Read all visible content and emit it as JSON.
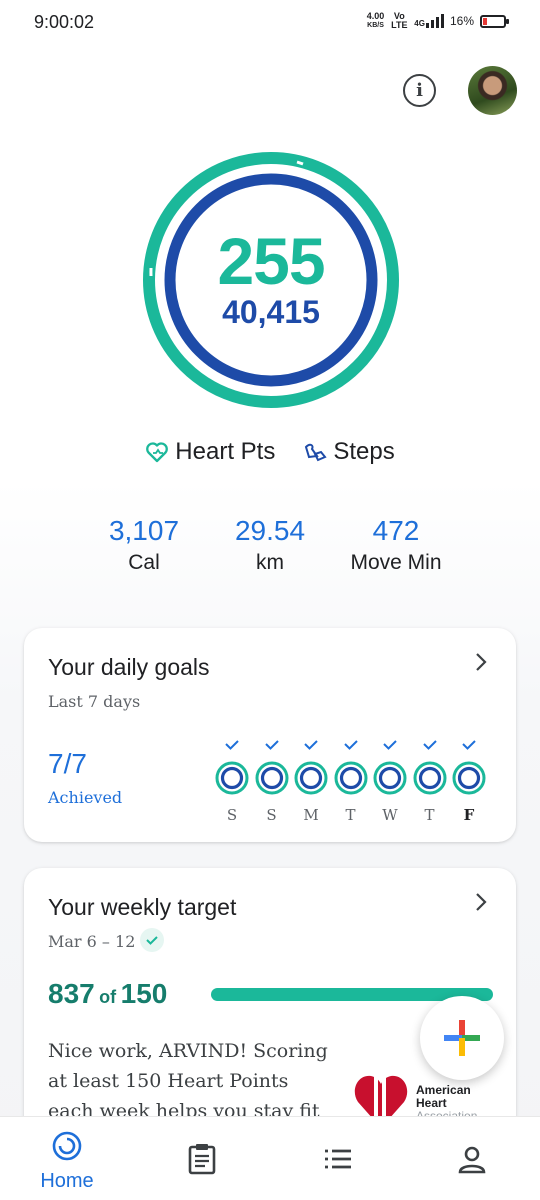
{
  "status": {
    "time": "9:00:02",
    "net_speed_value": "4.00",
    "net_speed_unit": "KB/S",
    "volte": "Vo LTE",
    "network": "4G",
    "battery": "16%"
  },
  "summary": {
    "heart_pts": "255",
    "steps": "40,415",
    "heart_label": "Heart Pts",
    "steps_label": "Steps"
  },
  "stats": [
    {
      "value": "3,107",
      "label": "Cal"
    },
    {
      "value": "29.54",
      "label": "km"
    },
    {
      "value": "472",
      "label": "Move Min"
    }
  ],
  "daily_goals": {
    "title": "Your daily goals",
    "subtitle": "Last 7 days",
    "achieved_value": "7/7",
    "achieved_label": "Achieved",
    "days": [
      "S",
      "S",
      "M",
      "T",
      "W",
      "T",
      "F"
    ]
  },
  "weekly_target": {
    "title": "Your weekly target",
    "date_range": "Mar 6 – 12",
    "progress_value": "837",
    "progress_of": "of",
    "progress_target": "150",
    "progress_fraction": 1.0,
    "message": "Nice work, ARVIND! Scoring at least 150 Heart Points each week helps you stay fit and",
    "aha_line1": "American",
    "aha_line2": "Heart",
    "aha_line3": "Association"
  },
  "nav": {
    "home": "Home"
  },
  "colors": {
    "heart_ring": "#1bb89a",
    "steps_ring": "#1e4ba8",
    "stat_blue": "#1e6fd9"
  },
  "icons": {
    "info": "info-icon",
    "heart": "heart-icon",
    "steps": "steps-icon",
    "add": "add-icon",
    "home": "home-icon",
    "journal": "journal-icon",
    "browse": "browse-icon",
    "profile": "profile-icon"
  }
}
